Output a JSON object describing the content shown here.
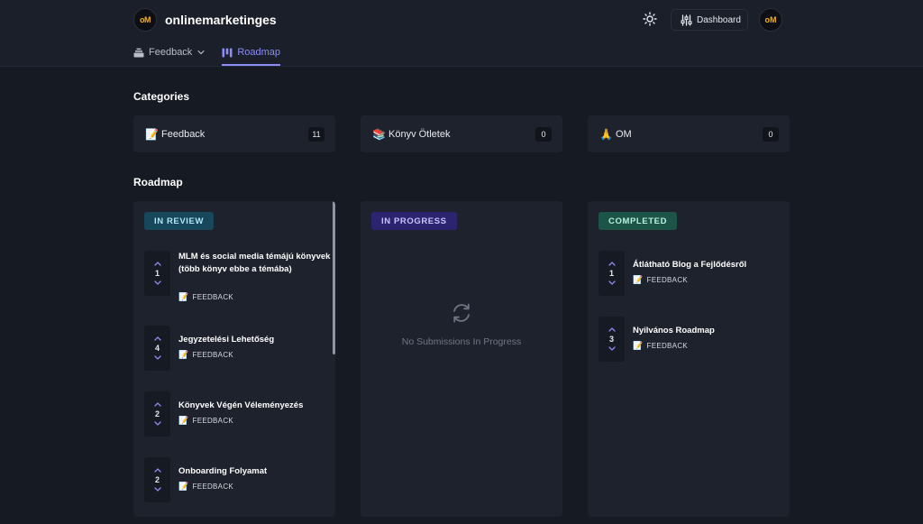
{
  "header": {
    "logo_text": "oM",
    "brand": "onlinemarketinges",
    "dashboard_label": "Dashboard",
    "avatar_text": "oM"
  },
  "nav": {
    "feedback_label": "Feedback",
    "roadmap_label": "Roadmap"
  },
  "categories": {
    "title": "Categories",
    "items": [
      {
        "emoji": "📝",
        "name": "Feedback",
        "count": "11"
      },
      {
        "emoji": "📚",
        "name": "Könyv Ötletek",
        "count": "0"
      },
      {
        "emoji": "🙏",
        "name": "OM",
        "count": "0"
      }
    ]
  },
  "roadmap": {
    "title": "Roadmap",
    "columns": [
      {
        "badge": "IN REVIEW",
        "badge_bg": "#17475a",
        "badge_color": "#aee7f5",
        "items": [
          {
            "votes": "1",
            "title": "MLM és social media témájú könyvek (több könyv ebbe a témába)",
            "tag_emoji": "📝",
            "tag": "FEEDBACK"
          },
          {
            "votes": "4",
            "title": "Jegyzetelési Lehetőség",
            "tag_emoji": "📝",
            "tag": "FEEDBACK"
          },
          {
            "votes": "2",
            "title": "Könyvek Végén Véleményezés",
            "tag_emoji": "📝",
            "tag": "FEEDBACK"
          },
          {
            "votes": "2",
            "title": "Onboarding Folyamat",
            "tag_emoji": "📝",
            "tag": "FEEDBACK"
          }
        ]
      },
      {
        "badge": "IN PROGRESS",
        "badge_bg": "#2d2470",
        "badge_color": "#c9c2ff",
        "empty_text": "No Submissions In Progress"
      },
      {
        "badge": "COMPLETED",
        "badge_bg": "#1c5447",
        "badge_color": "#b7f0dc",
        "items": [
          {
            "votes": "1",
            "title": "Átlátható Blog a Fejlődésről",
            "tag_emoji": "📝",
            "tag": "FEEDBACK"
          },
          {
            "votes": "3",
            "title": "Nyilvános Roadmap",
            "tag_emoji": "📝",
            "tag": "FEEDBACK"
          }
        ]
      }
    ]
  },
  "colors": {
    "accent": "#8d8cf5",
    "background": "#161a22",
    "card": "#1e222c"
  }
}
